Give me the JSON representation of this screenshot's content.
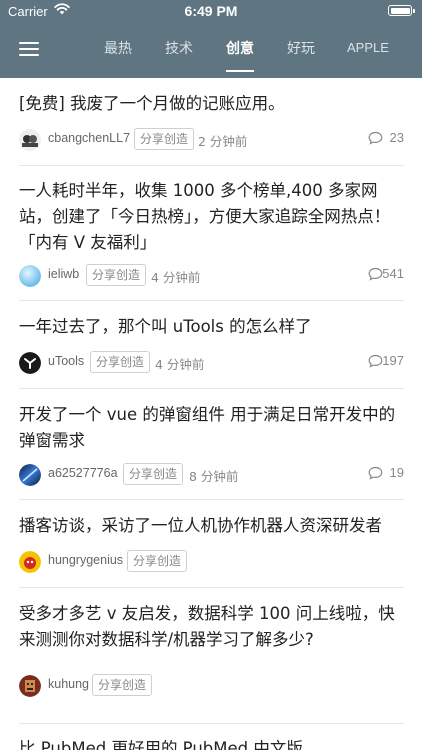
{
  "status_bar": {
    "carrier": "Carrier",
    "time": "6:49 PM"
  },
  "nav": {
    "tabs": [
      {
        "label": "最热"
      },
      {
        "label": "技术"
      },
      {
        "label": "创意"
      },
      {
        "label": "好玩"
      },
      {
        "label": "APPLE"
      }
    ],
    "active_tab": "创意"
  },
  "posts": [
    {
      "title": "[免费] 我废了一个月做的记账应用。",
      "author": "cbangchenLL7",
      "tag": "分享创造",
      "time": "2 分钟前",
      "comments": "23"
    },
    {
      "title": "一人耗时半年，收集 1000 多个榜单,400 多家网站，创建了「今日热榜」，方便大家追踪全网热点！「内有 V 友福利」",
      "author": "ieliwb",
      "tag": "分享创造",
      "time": "4 分钟前",
      "comments": "541"
    },
    {
      "title": "一年过去了，那个叫 uTools 的怎么样了",
      "author": "uTools",
      "tag": "分享创造",
      "time": "4 分钟前",
      "comments": "197"
    },
    {
      "title": "开发了一个 vue 的弹窗组件 用于满足日常开发中的弹窗需求",
      "author": "a62527776a",
      "tag": "分享创造",
      "time": "8 分钟前",
      "comments": "19"
    },
    {
      "title": "播客访谈，采访了一位人机协作机器人资深研发者",
      "author": "hungrygenius",
      "tag": "分享创造",
      "time": "",
      "comments": ""
    },
    {
      "title": "受多才多艺 v 友启发，数据科学 100 问上线啦，快来测测你对数据科学/机器学习了解多少?",
      "author": "kuhung",
      "tag": "分享创造",
      "time": "",
      "comments": ""
    },
    {
      "title": "比 PubMed 更好用的 PubMed 中文版",
      "author": "",
      "tag": "",
      "time": "",
      "comments": ""
    }
  ]
}
